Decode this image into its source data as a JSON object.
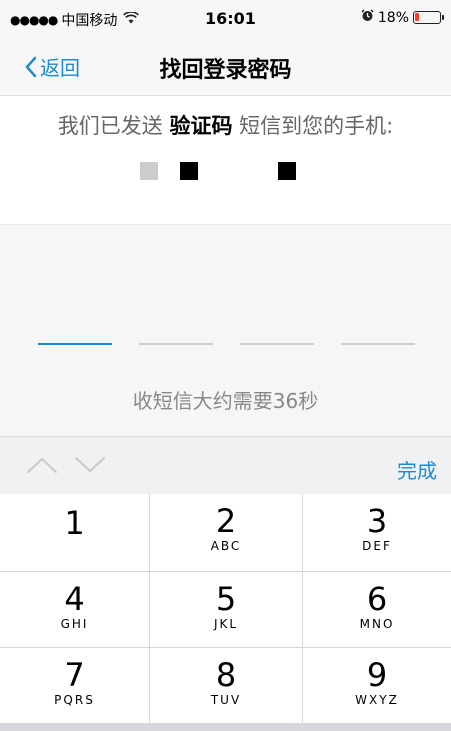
{
  "status_bar": {
    "signal_dots": "●●●●●",
    "carrier": "中国移动",
    "wifi_icon": "wifi-icon",
    "time": "16:01",
    "alarm_icon": "alarm-icon",
    "battery_percent": "18%",
    "battery_level": 0.18,
    "battery_color": "#ff3b30"
  },
  "nav": {
    "back_label": "返回",
    "title": "找回登录密码"
  },
  "message": {
    "prefix": "我们已发送 ",
    "emphasis": "验证码",
    "suffix": " 短信到您的手机:"
  },
  "code_input": {
    "slots": [
      "",
      "",
      "",
      ""
    ],
    "active_slot": 0,
    "accent_color": "#1a8bd6"
  },
  "hint": "收短信大约需要36秒",
  "toolbar": {
    "done_label": "完成"
  },
  "keypad": {
    "keys": [
      {
        "num": "1",
        "letters": ""
      },
      {
        "num": "2",
        "letters": "ABC"
      },
      {
        "num": "3",
        "letters": "DEF"
      },
      {
        "num": "4",
        "letters": "GHI"
      },
      {
        "num": "5",
        "letters": "JKL"
      },
      {
        "num": "6",
        "letters": "MNO"
      },
      {
        "num": "7",
        "letters": "PQRS"
      },
      {
        "num": "8",
        "letters": "TUV"
      },
      {
        "num": "9",
        "letters": "WXYZ"
      }
    ]
  }
}
